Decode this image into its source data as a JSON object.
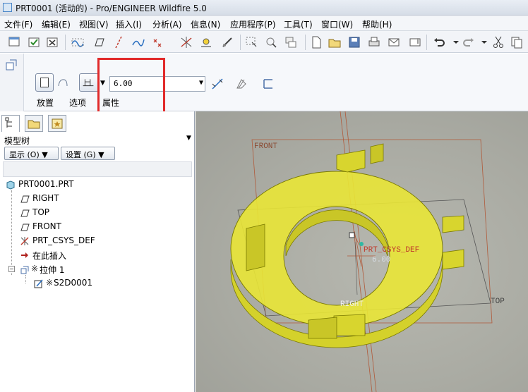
{
  "window": {
    "title": "PRT0001 (活动的) - Pro/ENGINEER Wildfire 5.0"
  },
  "menu": [
    "文件(F)",
    "编辑(E)",
    "视图(V)",
    "插入(I)",
    "分析(A)",
    "信息(N)",
    "应用程序(P)",
    "工具(T)",
    "窗口(W)",
    "帮助(H)"
  ],
  "dashboard": {
    "depth_value": "6.00",
    "tabs": [
      "放置",
      "选项",
      "属性"
    ]
  },
  "model_tree": {
    "header": "模型树",
    "show_button": "显示",
    "show_shortcut": "(O)",
    "settings_button": "设置",
    "settings_shortcut": "(G)",
    "root": "PRT0001.PRT",
    "items": [
      "RIGHT",
      "TOP",
      "FRONT",
      "PRT_CSYS_DEF",
      "在此插入"
    ],
    "feature": "拉伸 1",
    "sketch": "S2D0001"
  },
  "viewport": {
    "labels": {
      "front": "FRONT",
      "top": "TOP",
      "right": "RIGHT",
      "csys": "PRT_CSYS_DEF",
      "dim": "6.00"
    },
    "colors": {
      "part_fill": "#e9e636",
      "part_edge": "#7a7a00",
      "datum": "#b05a3a",
      "highlight": "#e12a2a"
    }
  }
}
